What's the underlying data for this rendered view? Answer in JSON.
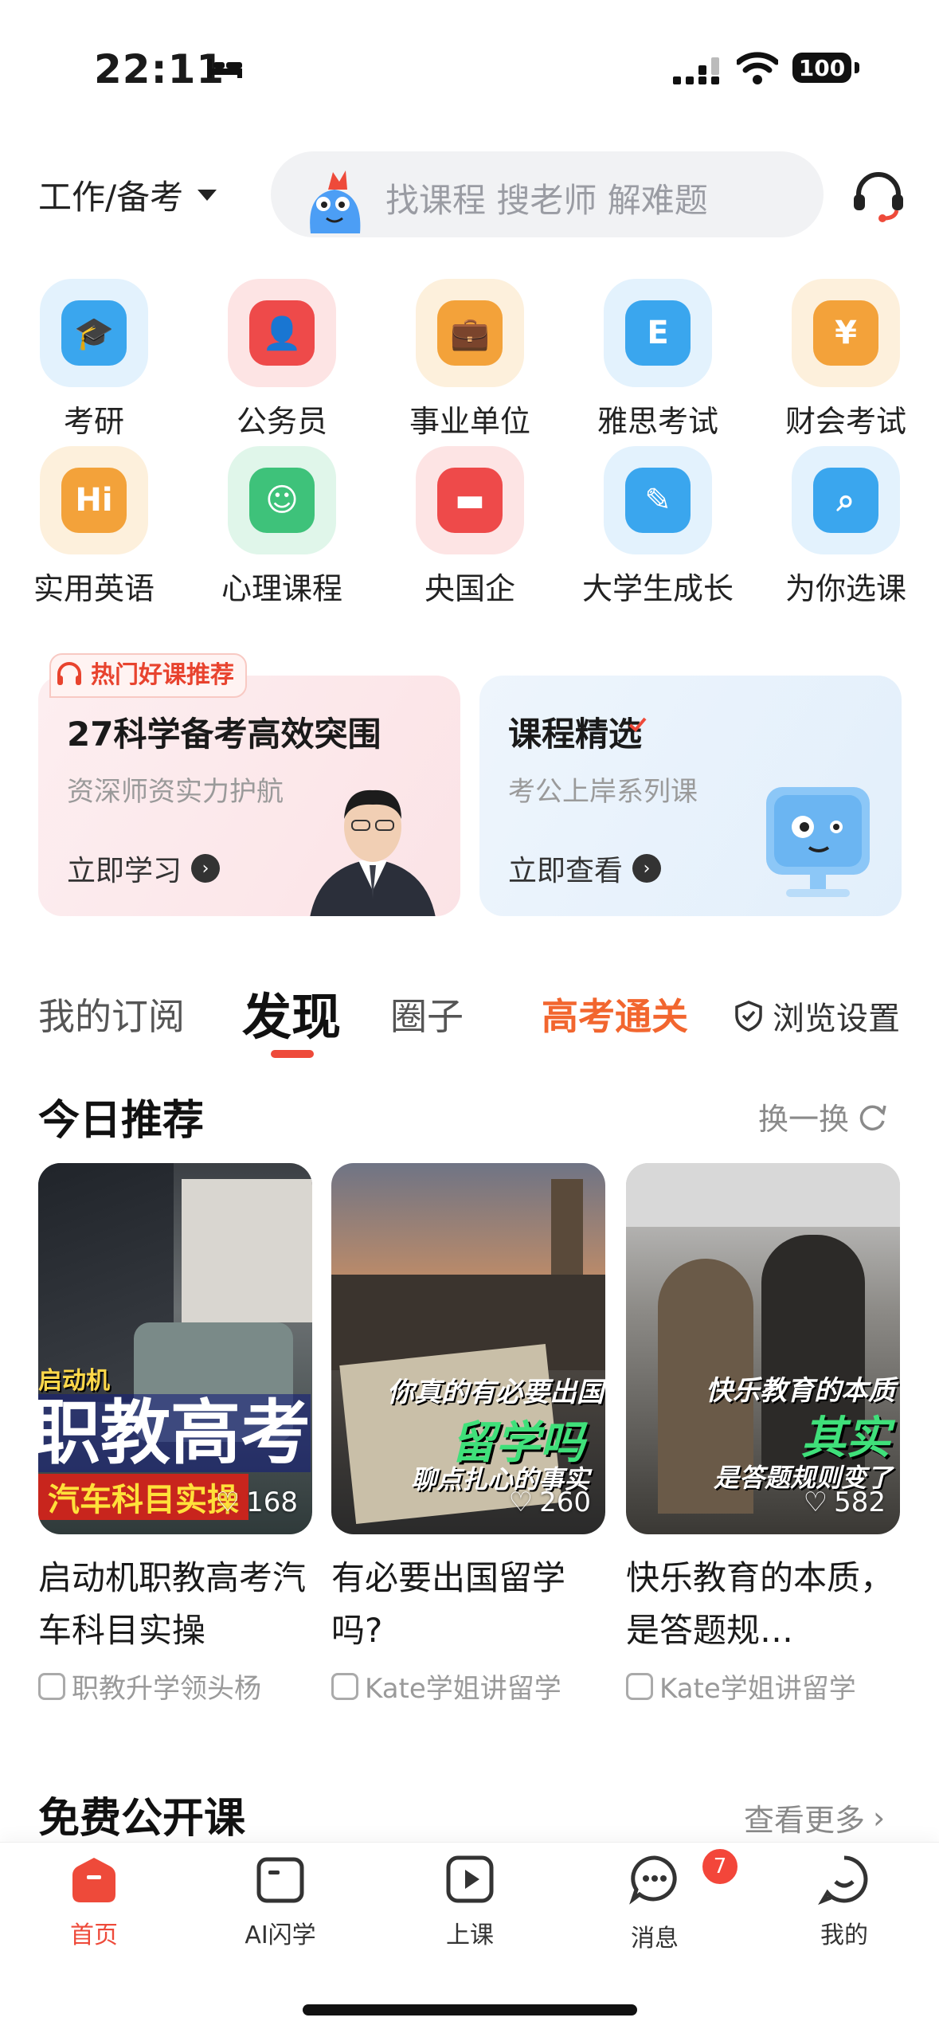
{
  "status": {
    "time": "22:11",
    "battery": "100"
  },
  "header": {
    "category": "工作/备考",
    "search_placeholder": "找课程 搜老师 解难题"
  },
  "grid": [
    {
      "label": "考研",
      "icon": "graduation-cap-icon",
      "color": "#3aa6ee"
    },
    {
      "label": "公务员",
      "icon": "civil-servant-icon",
      "color": "#ee4a4a"
    },
    {
      "label": "事业单位",
      "icon": "briefcase-icon",
      "color": "#f3a23a"
    },
    {
      "label": "雅思考试",
      "icon": "ielts-icon",
      "color": "#3aa6ee"
    },
    {
      "label": "财会考试",
      "icon": "yen-clipboard-icon",
      "color": "#f3a23a"
    },
    {
      "label": "实用英语",
      "icon": "hi-chat-icon",
      "color": "#f3a23a"
    },
    {
      "label": "心理课程",
      "icon": "smile-chat-icon",
      "color": "#3ec27a"
    },
    {
      "label": "央国企",
      "icon": "soe-icon",
      "color": "#ee4a4a"
    },
    {
      "label": "大学生成长",
      "icon": "note-edit-icon",
      "color": "#3aa6ee"
    },
    {
      "label": "为你选课",
      "icon": "search-monitor-icon",
      "color": "#3aa6ee"
    }
  ],
  "promo": {
    "hot_badge": "热门好课推荐",
    "left": {
      "title": "27科学备考高效突围",
      "subtitle": "资深师资实力护航",
      "link": "立即学习"
    },
    "right": {
      "title": "课程精选",
      "subtitle": "考公上岸系列课",
      "link": "立即查看"
    }
  },
  "tabs": {
    "subscriptions": "我的订阅",
    "discover": "发现",
    "circle": "圈子",
    "gaokao": "高考通关",
    "browse_settings": "浏览设置"
  },
  "today": {
    "title": "今日推荐",
    "refresh": "换一换",
    "videos": [
      {
        "title": "启动机职教高考汽车科目实操",
        "author": "职教升学领头杨",
        "likes": "168",
        "overlay_top": "启动机",
        "overlay_main": "职教高考",
        "overlay_sub": "汽车科目实操"
      },
      {
        "title": "有必要出国留学吗?",
        "author": "Kate学姐讲留学",
        "likes": "260",
        "overlay_top": "你真的有必要出国",
        "overlay_main": "留学吗",
        "overlay_sub": "聊点扎心的事实"
      },
      {
        "title": "快乐教育的本质，是答题规…",
        "author": "Kate学姐讲留学",
        "likes": "582",
        "overlay_top": "快乐教育的本质",
        "overlay_main": "其实",
        "overlay_sub": "是答题规则变了"
      }
    ]
  },
  "free_course": {
    "title": "免费公开课",
    "more": "查看更多"
  },
  "nav": [
    {
      "label": "首页",
      "active": true
    },
    {
      "label": "AI闪学",
      "active": false
    },
    {
      "label": "上课",
      "active": false
    },
    {
      "label": "消息",
      "active": false,
      "badge": "7"
    },
    {
      "label": "我的",
      "active": false
    }
  ]
}
